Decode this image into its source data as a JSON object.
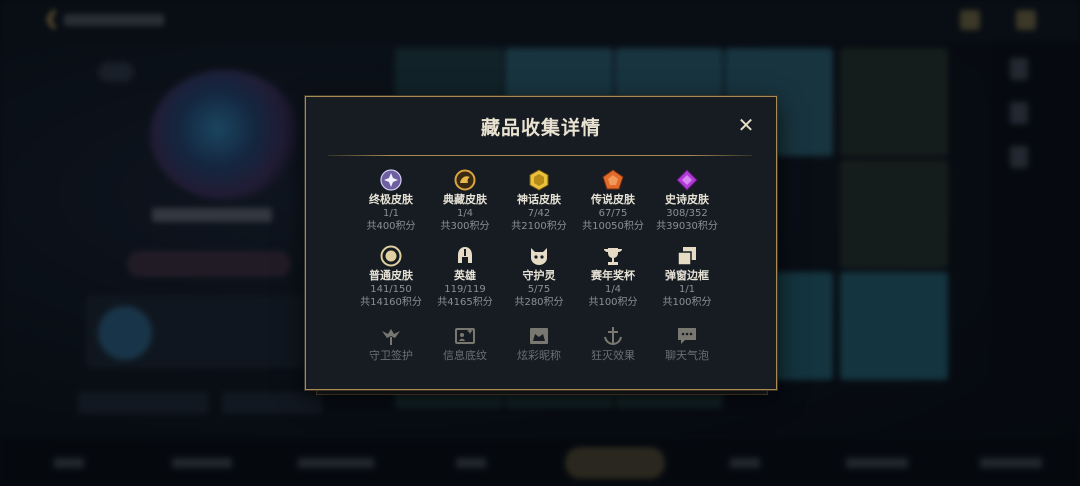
{
  "modal": {
    "title": "藏品收集详情",
    "close_icon": "close-icon"
  },
  "categories": [
    {
      "name": "终极皮肤",
      "count": "1/1",
      "points": "共400积分",
      "icon": "ultimate-skin-icon",
      "color": "#b8a6e8"
    },
    {
      "name": "典藏皮肤",
      "count": "1/4",
      "points": "共300积分",
      "icon": "mythic-skin-icon",
      "color": "#d9a640"
    },
    {
      "name": "神话皮肤",
      "count": "7/42",
      "points": "共2100积分",
      "icon": "myth-skin-icon",
      "color": "#e8c23a"
    },
    {
      "name": "传说皮肤",
      "count": "67/75",
      "points": "共10050积分",
      "icon": "legendary-skin-icon",
      "color": "#e26a2a"
    },
    {
      "name": "史诗皮肤",
      "count": "308/352",
      "points": "共39030积分",
      "icon": "epic-skin-icon",
      "color": "#b33ad8"
    },
    {
      "name": "普通皮肤",
      "count": "141/150",
      "points": "共14160积分",
      "icon": "standard-skin-icon",
      "color": "#e0cfa0"
    },
    {
      "name": "英雄",
      "count": "119/119",
      "points": "共4165积分",
      "icon": "champion-helmet-icon",
      "color": "#e6dcc6"
    },
    {
      "name": "守护灵",
      "count": "5/75",
      "points": "共280积分",
      "icon": "guardian-spirit-icon",
      "color": "#e6dcc6"
    },
    {
      "name": "赛年奖杯",
      "count": "1/4",
      "points": "共100积分",
      "icon": "trophy-icon",
      "color": "#e6dcc6"
    },
    {
      "name": "弹窗边框",
      "count": "1/1",
      "points": "共100积分",
      "icon": "popup-border-icon",
      "color": "#e6dcc6"
    }
  ],
  "faded_categories": [
    {
      "name": "守卫签护",
      "icon": "ward-icon"
    },
    {
      "name": "信息底纹",
      "icon": "info-card-icon"
    },
    {
      "name": "炫彩昵称",
      "icon": "chroma-name-icon"
    },
    {
      "name": "狂灭效果",
      "icon": "finisher-effect-icon"
    },
    {
      "name": "聊天气泡",
      "icon": "chat-bubble-icon"
    }
  ]
}
